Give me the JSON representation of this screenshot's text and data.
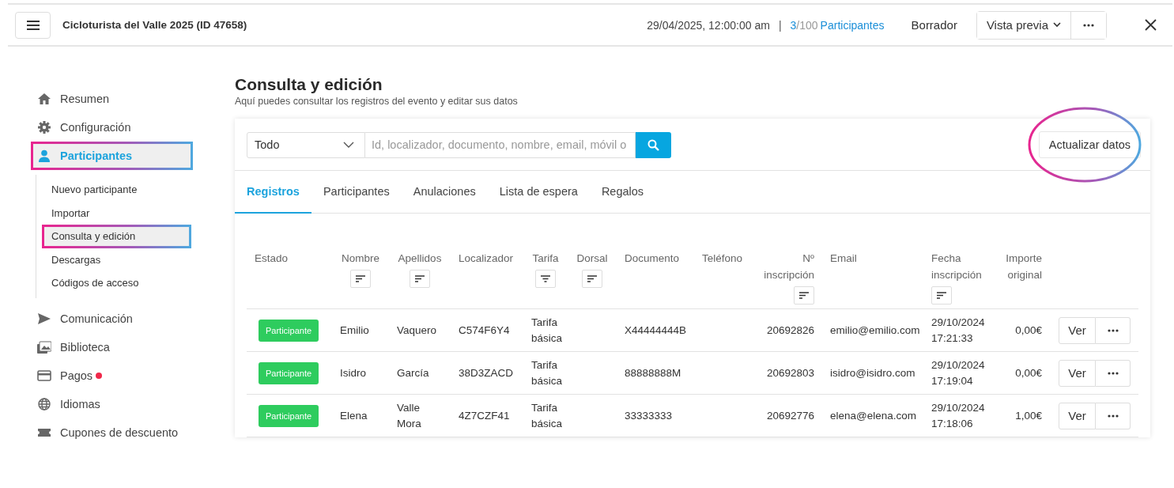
{
  "header": {
    "event_title": "Cicloturista del Valle 2025 (ID 47658)",
    "date": "29/04/2025, 12:00:00 am",
    "separator": "|",
    "participants_count": "3",
    "participants_total": "/100",
    "participants_label": "Participantes",
    "status": "Borrador",
    "preview_button": "Vista previa"
  },
  "sidebar": {
    "items": [
      {
        "label": "Resumen",
        "selected": false,
        "highlighted": false,
        "badge_dot": false
      },
      {
        "label": "Configuración",
        "selected": false,
        "highlighted": false,
        "badge_dot": false
      },
      {
        "label": "Participantes",
        "selected": true,
        "highlighted": true,
        "badge_dot": false,
        "children": [
          {
            "label": "Nuevo participante",
            "selected": false,
            "highlighted": false
          },
          {
            "label": "Importar",
            "selected": false,
            "highlighted": false
          },
          {
            "label": "Consulta y edición",
            "selected": true,
            "highlighted": true
          },
          {
            "label": "Descargas",
            "selected": false,
            "highlighted": false
          },
          {
            "label": "Códigos de acceso",
            "selected": false,
            "highlighted": false
          }
        ]
      },
      {
        "label": "Comunicación",
        "selected": false,
        "highlighted": false,
        "badge_dot": false
      },
      {
        "label": "Biblioteca",
        "selected": false,
        "highlighted": false,
        "badge_dot": false
      },
      {
        "label": "Pagos",
        "selected": false,
        "highlighted": false,
        "badge_dot": true
      },
      {
        "label": "Idiomas",
        "selected": false,
        "highlighted": false,
        "badge_dot": false
      },
      {
        "label": "Cupones de descuento",
        "selected": false,
        "highlighted": false,
        "badge_dot": false
      }
    ]
  },
  "page": {
    "title": "Consulta y edición",
    "subtitle": "Aquí puedes consultar los registros del evento y editar sus datos"
  },
  "search": {
    "filter_value": "Todo",
    "placeholder": "Id, localizador, documento, nombre, email, móvil o",
    "refresh_button": "Actualizar datos",
    "refresh_highlighted": true
  },
  "tabs": [
    {
      "label": "Registros",
      "selected": true
    },
    {
      "label": "Participantes",
      "selected": false
    },
    {
      "label": "Anulaciones",
      "selected": false
    },
    {
      "label": "Lista de espera",
      "selected": false
    },
    {
      "label": "Regalos",
      "selected": false
    }
  ],
  "table": {
    "columns": [
      {
        "label": "Estado",
        "kind": "plain"
      },
      {
        "label": "Nombre",
        "kind": "sortable"
      },
      {
        "label": "Apellidos",
        "kind": "sortable"
      },
      {
        "label": "Localizador",
        "kind": "plain"
      },
      {
        "label": "Tarifa",
        "kind": "filterable"
      },
      {
        "label": "Dorsal",
        "kind": "sortable"
      },
      {
        "label": "Documento",
        "kind": "plain"
      },
      {
        "label": "Teléfono",
        "kind": "plain"
      },
      {
        "label": "Nº inscripción",
        "kind": "numericsortable"
      },
      {
        "label": "Email",
        "kind": "plain"
      },
      {
        "label": "Fecha inscripción",
        "kind": "sortable"
      },
      {
        "label": "Importe original",
        "kind": "numeric"
      }
    ],
    "rows": [
      {
        "cells": [
          "Participante",
          "Emilio",
          "Vaquero",
          "C574F6Y4",
          "Tarifa básica",
          "",
          "X44444444B",
          "",
          "20692826",
          "emilio@emilio.com",
          "29/10/2024 17:21:33",
          "0,00€"
        ],
        "view_button": "Ver"
      },
      {
        "cells": [
          "Participante",
          "Isidro",
          "García",
          "38D3ZACD",
          "Tarifa básica",
          "",
          "88888888M",
          "",
          "20692803",
          "isidro@isidro.com",
          "29/10/2024 17:19:04",
          "0,00€"
        ],
        "view_button": "Ver"
      },
      {
        "cells": [
          "Participante",
          "Elena",
          "Valle Mora",
          "4Z7CZF41",
          "Tarifa básica",
          "",
          "33333333",
          "",
          "20692776",
          "elena@elena.com",
          "29/10/2024 17:18:06",
          "1,00€"
        ],
        "view_button": "Ver"
      }
    ]
  }
}
